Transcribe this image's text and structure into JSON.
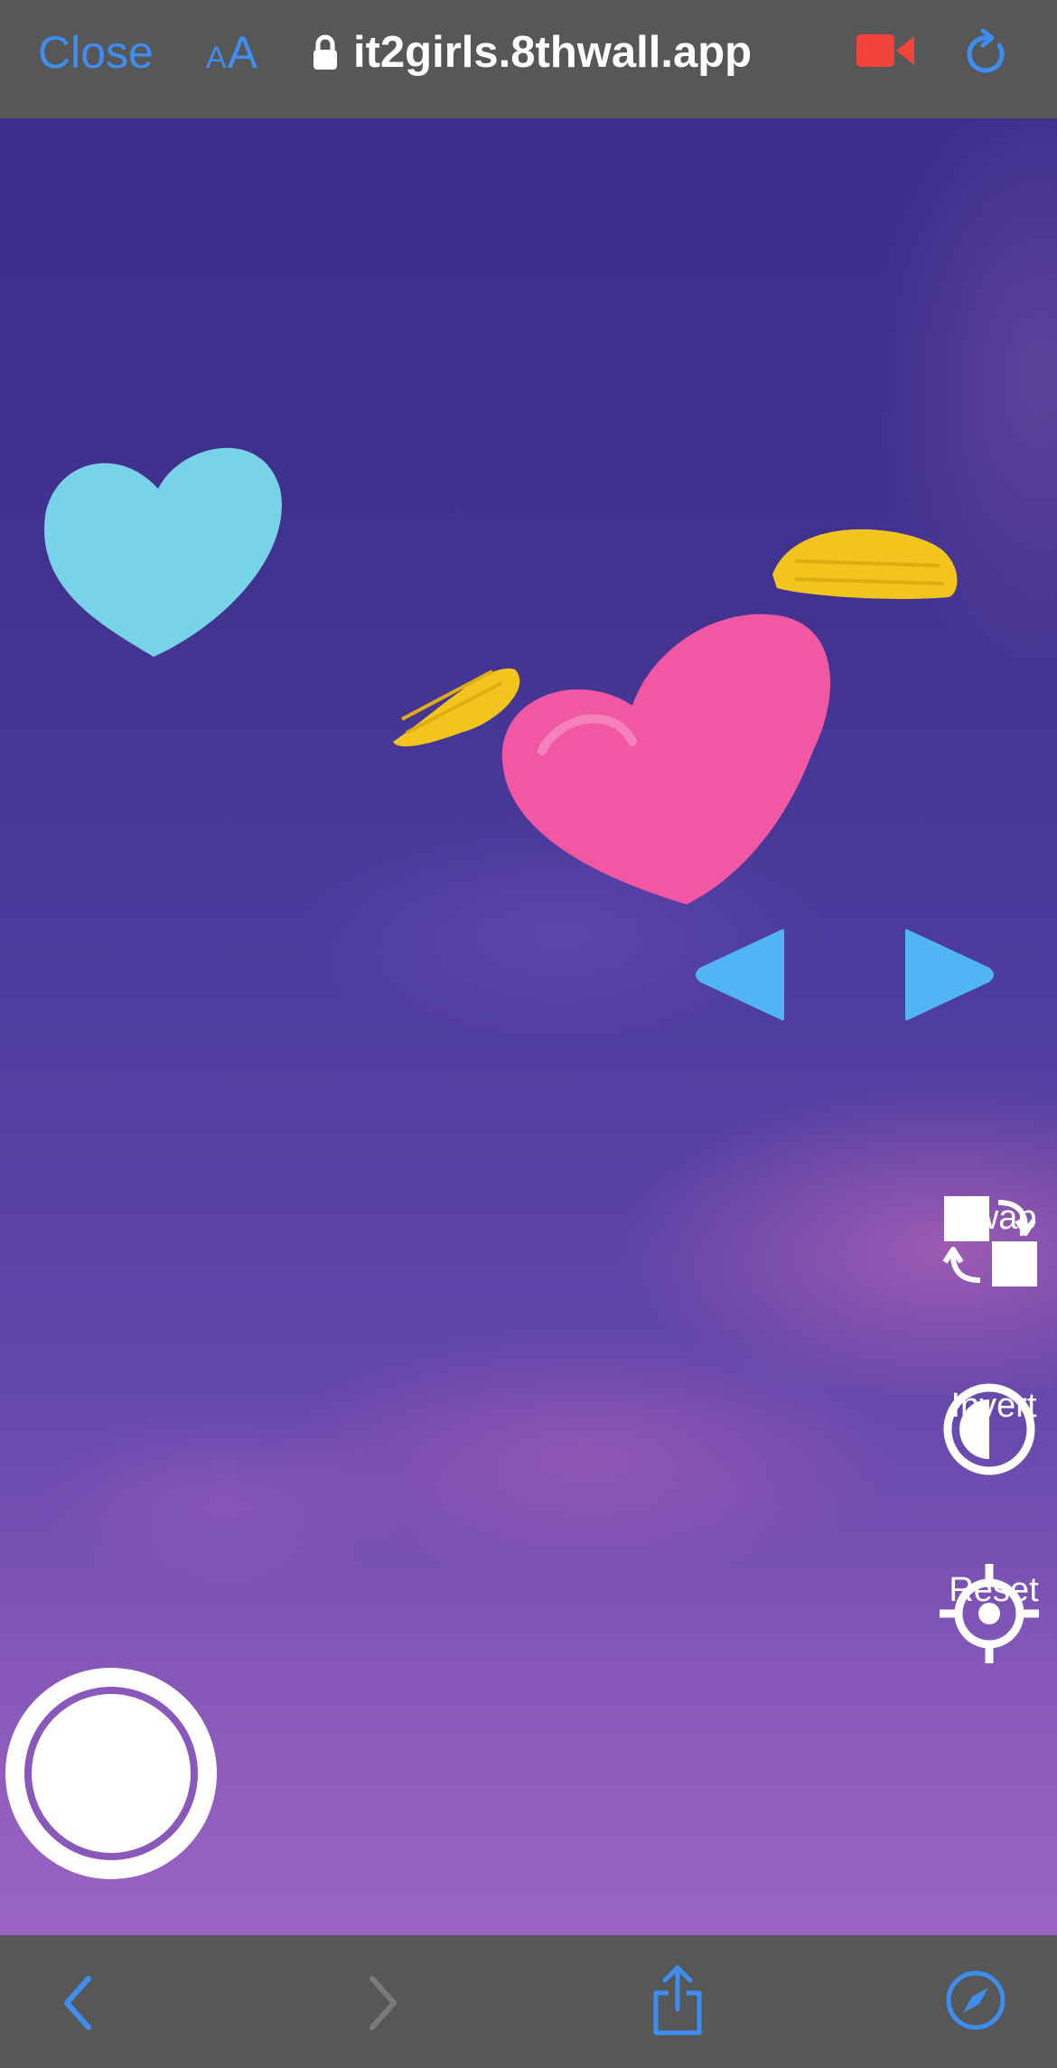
{
  "browser": {
    "close_label": "Close",
    "text_size_label_small": "A",
    "text_size_label_large": "A",
    "url": "it2girls.8thwall.app",
    "icons": [
      "lock-icon",
      "video-record-icon",
      "reload-icon"
    ]
  },
  "ar_controls": {
    "swap_label": "Swap",
    "invert_label": "Invert",
    "reset_label": "Reset"
  },
  "colors": {
    "browser_accent": "#3d8ef0",
    "recording_red": "#f2443a",
    "heart_pink": "#f257a4",
    "heart_cyan": "#78d3e8",
    "wings_yellow": "#f2c41e",
    "arrow_blue": "#50b4f5"
  },
  "bottom_toolbar": {
    "icons": [
      "back-icon",
      "forward-icon",
      "share-icon",
      "compass-icon"
    ]
  }
}
